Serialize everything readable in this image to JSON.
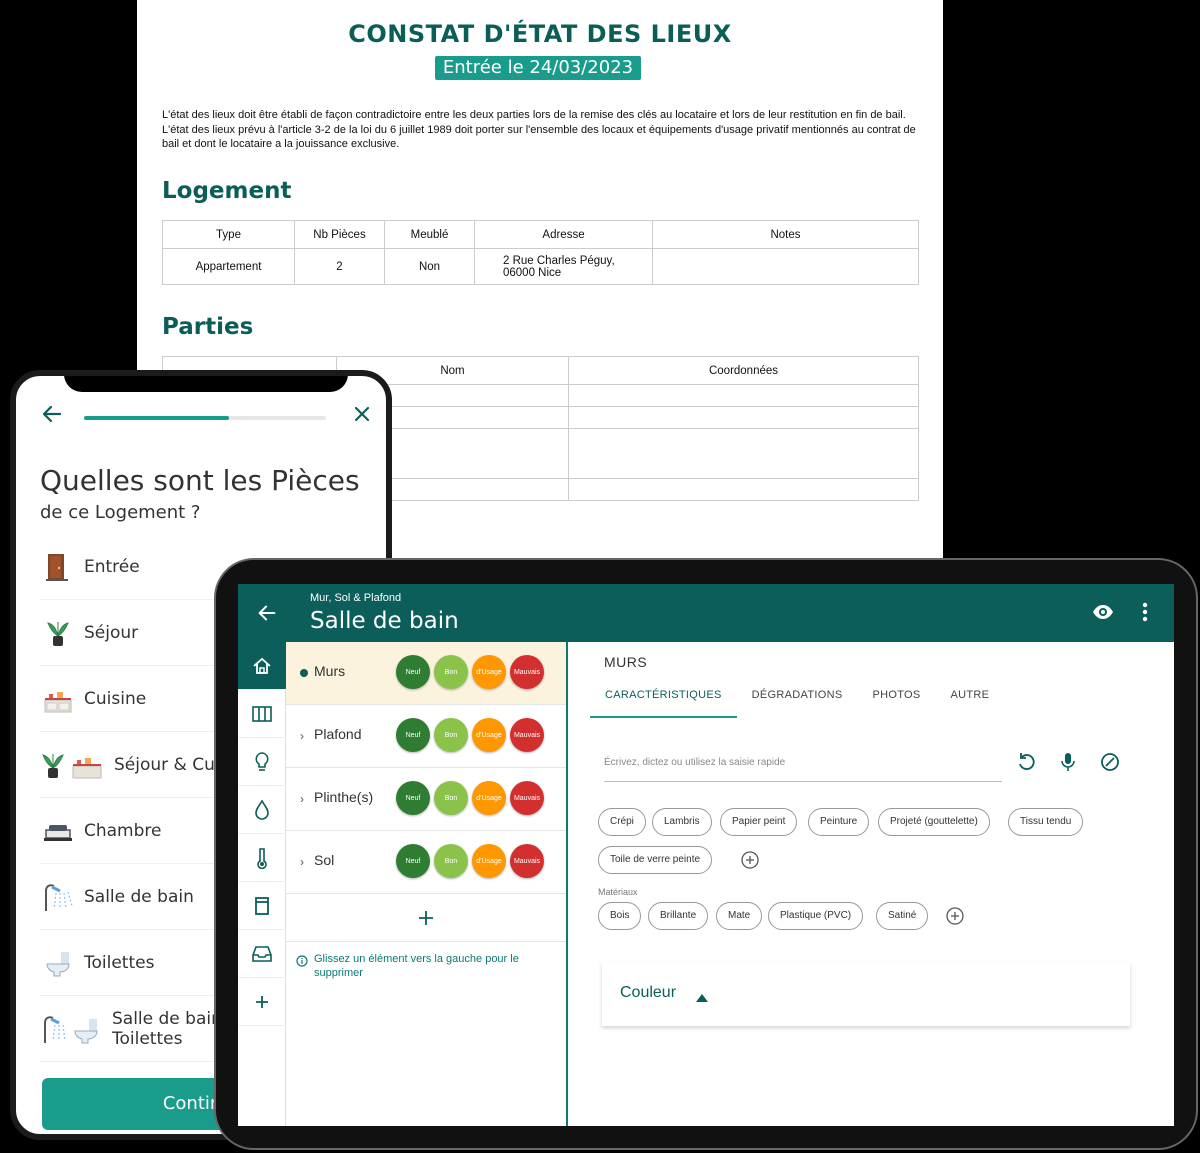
{
  "document": {
    "title": "CONSTAT D'ÉTAT DES LIEUX",
    "date_badge": "Entrée le 24/03/2023",
    "intro": "L'état des lieux doit être établi de façon contradictoire entre les deux parties lors de la remise des clés au locataire et lors de leur restitution en fin de bail. L'état des lieux prévu à l'article 3-2 de la loi du 6 juillet 1989 doit porter sur l'ensemble des locaux et équipements d'usage privatif mentionnés au contrat de bail et dont le locataire a la jouissance exclusive.",
    "section_logement": "Logement",
    "logement_headers": [
      "Type",
      "Nb Pièces",
      "Meublé",
      "Adresse",
      "Notes"
    ],
    "logement_row": {
      "type": "Appartement",
      "pieces": "2",
      "meuble": "Non",
      "adresse_l1": "2 Rue Charles Péguy,",
      "adresse_l2": "06000 Nice",
      "notes": ""
    },
    "section_parties": "Parties",
    "parties_headers": [
      "",
      "Nom",
      "Coordonnées"
    ]
  },
  "phone": {
    "progress": 0.6,
    "question_line1": "Quelles sont les Pièces",
    "question_line2": "de ce Logement ?",
    "rooms": [
      {
        "label": "Entrée",
        "icon": "door-icon"
      },
      {
        "label": "Séjour",
        "icon": "plant-icon"
      },
      {
        "label": "Cuisine",
        "icon": "kitchen-icon"
      },
      {
        "label": "Séjour & Cuisine",
        "icon": "plant-kitchen-icon"
      },
      {
        "label": "Chambre",
        "icon": "bed-icon"
      },
      {
        "label": "Salle de bain",
        "icon": "shower-icon"
      },
      {
        "label": "Toilettes",
        "icon": "toilet-icon"
      },
      {
        "label_l1": "Salle de bain",
        "label_l2": "Toilettes",
        "icon": "shower-toilet-icon"
      }
    ],
    "cta": "Continuer"
  },
  "tablet": {
    "subtitle": "Mur, Sol & Plafond",
    "title": "Salle de bain",
    "elements": [
      {
        "label": "Murs",
        "selected": true
      },
      {
        "label": "Plafond",
        "selected": false
      },
      {
        "label": "Plinthe(s)",
        "selected": false
      },
      {
        "label": "Sol",
        "selected": false
      }
    ],
    "states": [
      "Neuf",
      "Bon",
      "d'Usage",
      "Mauvais"
    ],
    "state_colors": [
      "#2e7d32",
      "#8bc34a",
      "#ff9800",
      "#d32f2f"
    ],
    "hint": "Glissez un élément vers la gauche pour le supprimer",
    "detail_title": "MURS",
    "tabs": [
      "CARACTÉRISTIQUES",
      "DÉGRADATIONS",
      "PHOTOS",
      "AUTRE"
    ],
    "input_placeholder": "Écrivez, dictez ou utilisez la saisie rapide",
    "chips_row1": [
      "Crépi",
      "Lambris",
      "Papier peint",
      "Peinture",
      "Projeté (gouttelette)",
      "Tissu tendu"
    ],
    "chips_row2": [
      "Toile de verre peinte"
    ],
    "materials_label": "Matériaux",
    "chips_materials": [
      "Bois",
      "Brillante",
      "Mate",
      "Plastique (PVC)",
      "Satiné"
    ],
    "color_section": "Couleur",
    "colors": {
      "primary": "#0b5e5a",
      "accent": "#1a9c8c"
    }
  }
}
